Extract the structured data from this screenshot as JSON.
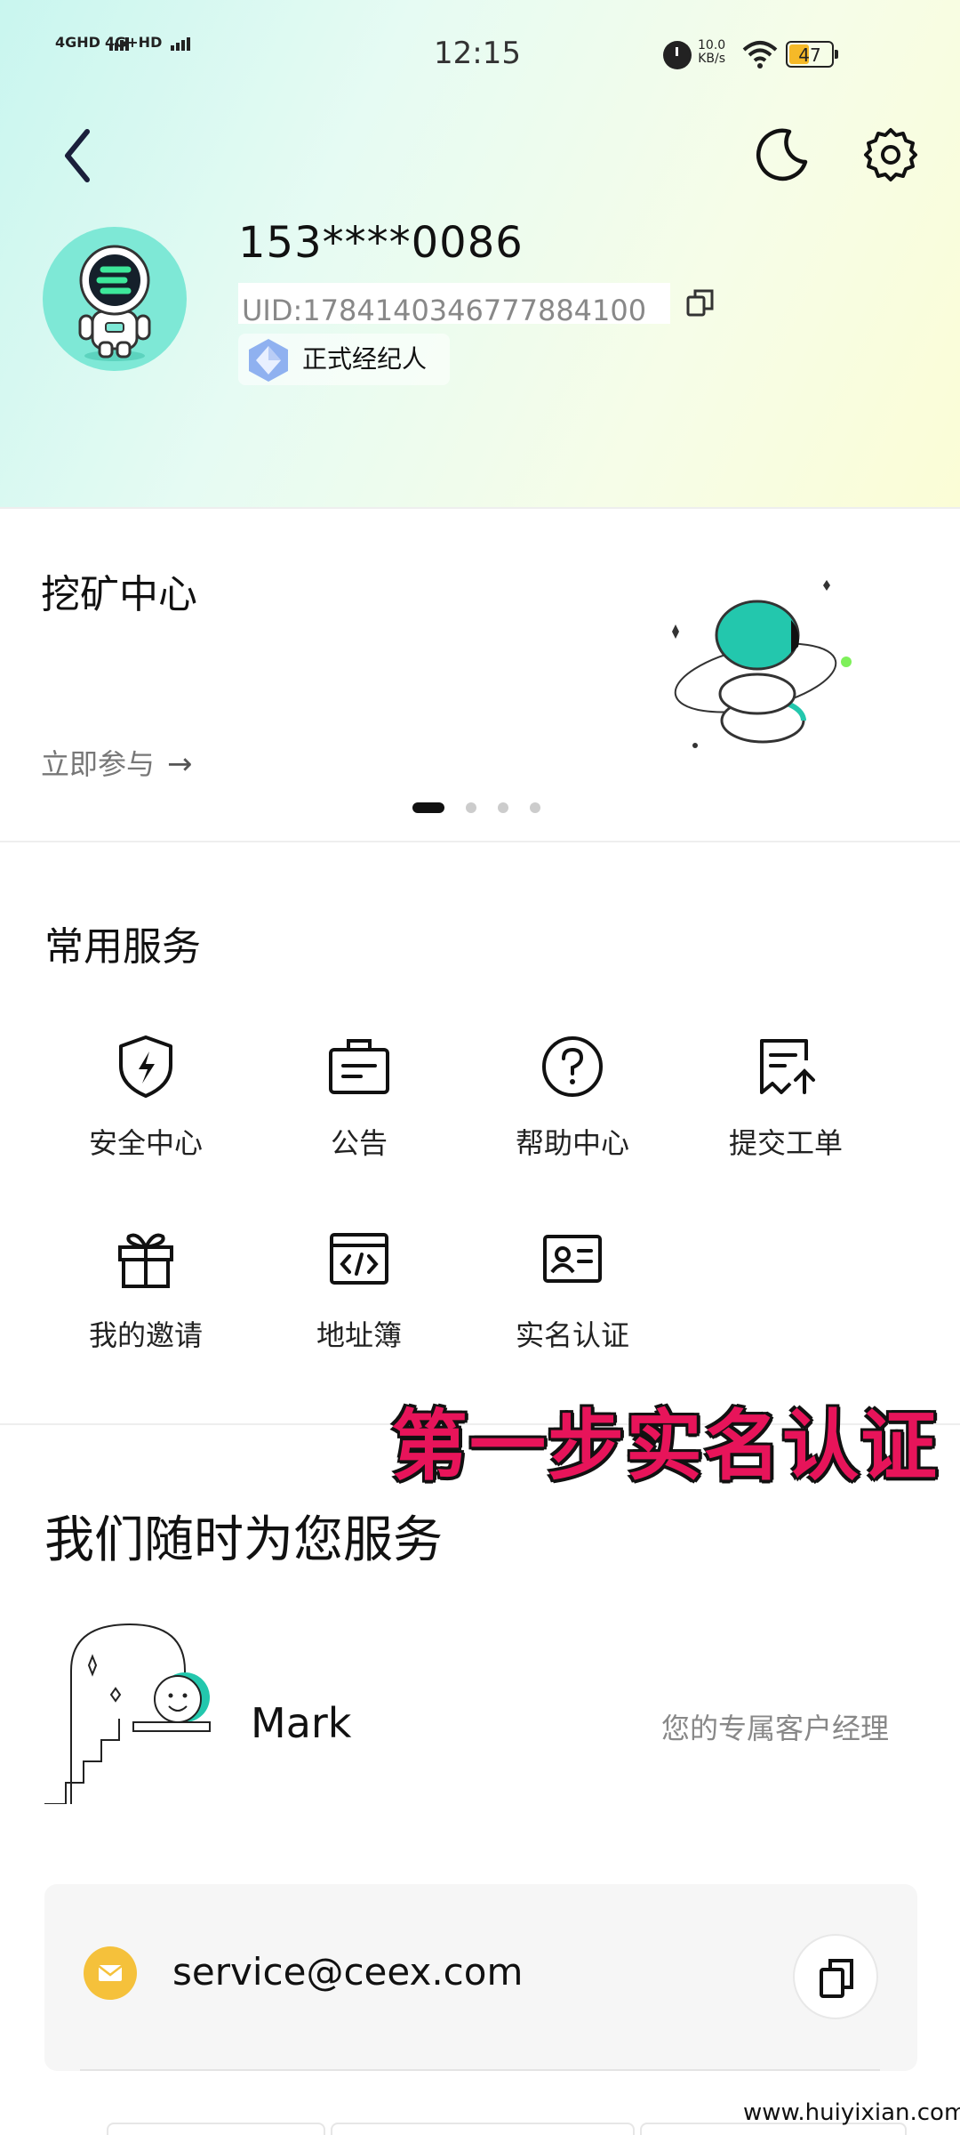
{
  "status_bar": {
    "signal_1": "4GHD",
    "signal_2": "4G+HD",
    "time": "12:15",
    "net_speed_value": "10.0",
    "net_speed_unit": "KB/s",
    "battery": "47"
  },
  "header": {
    "back_icon": "chevron-left-icon",
    "theme_icon": "moon-icon",
    "settings_icon": "gear-icon"
  },
  "profile": {
    "phone": "153****0086",
    "uid": "UID:1784140346777884100",
    "badge": "正式经纪人"
  },
  "banner": {
    "title": "挖矿中心",
    "link": "立即参与",
    "arrow": "→",
    "page_count": 4,
    "active_page": 1
  },
  "services": {
    "title": "常用服务",
    "items": [
      {
        "label": "安全中心",
        "icon": "shield-icon"
      },
      {
        "label": "公告",
        "icon": "announcement-icon"
      },
      {
        "label": "帮助中心",
        "icon": "help-icon"
      },
      {
        "label": "提交工单",
        "icon": "ticket-icon"
      },
      {
        "label": "我的邀请",
        "icon": "gift-icon"
      },
      {
        "label": "地址簿",
        "icon": "address-book-icon"
      },
      {
        "label": "实名认证",
        "icon": "id-card-icon"
      }
    ]
  },
  "overlay_caption": "第一步实名认证",
  "support": {
    "title": "我们随时为您服务",
    "manager_name": "Mark",
    "manager_role": "您的专属客户经理",
    "email": "service@ceex.com"
  },
  "watermark": "www.huiyixian.com",
  "colors": {
    "accent_teal": "#23c7ad",
    "mail_yellow": "#f5c13b",
    "overlay_pink": "#e7145a"
  }
}
